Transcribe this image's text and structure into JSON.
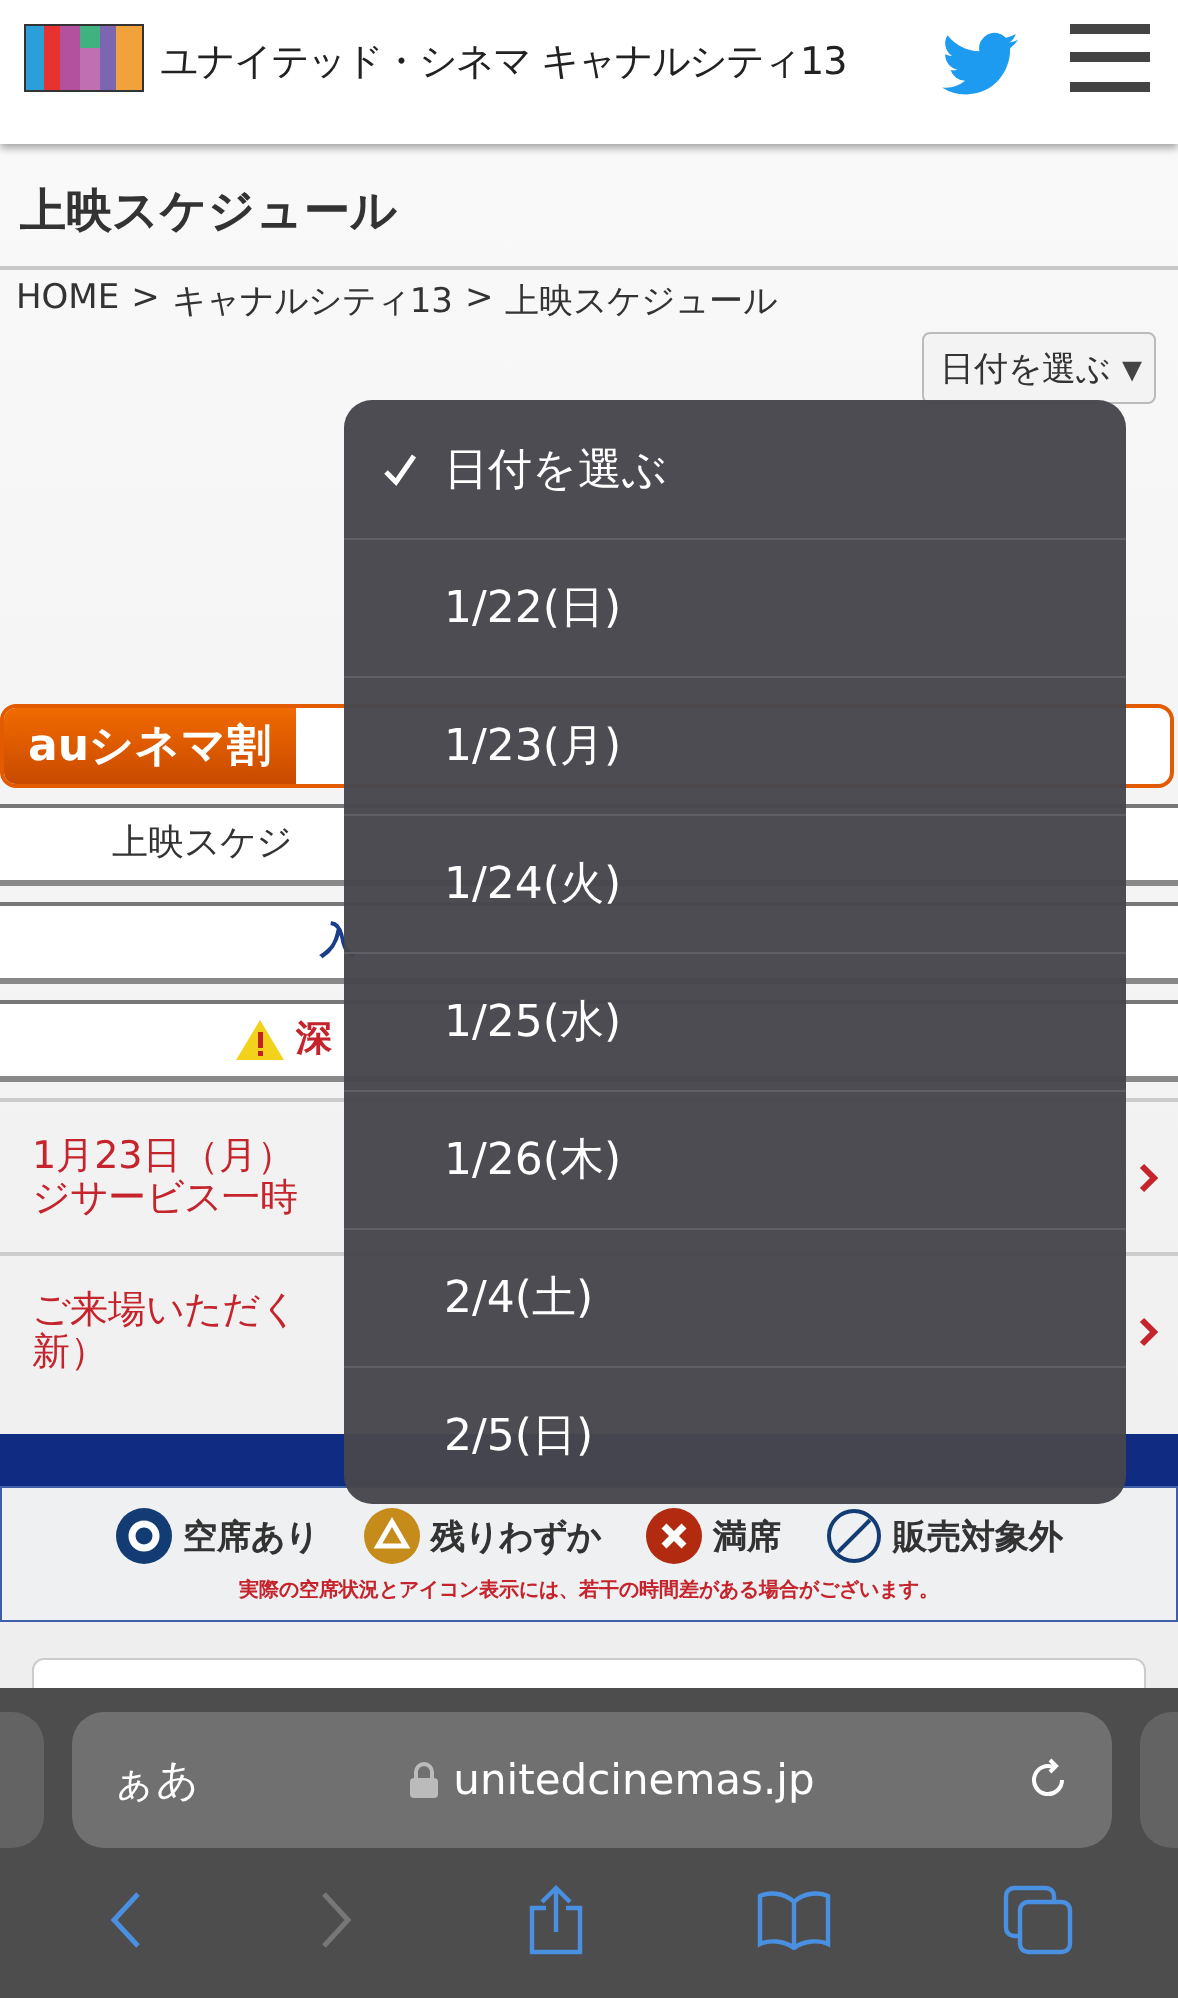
{
  "header": {
    "site_name": "ユナイテッド・シネマ キャナルシティ13"
  },
  "page_title": "上映スケジュール",
  "breadcrumb": [
    "HOME",
    ">",
    "キャナルシティ13",
    ">",
    "上映スケジュール"
  ],
  "date_select": {
    "value": "日付を選ぶ",
    "arrow": "▾"
  },
  "au_banner": {
    "label": "auシネマ割"
  },
  "rows": [
    {
      "kind": "plain",
      "text": "上映スケジ"
    },
    {
      "kind": "link",
      "text": "入"
    },
    {
      "kind": "warning",
      "text": "深"
    }
  ],
  "notices": [
    {
      "lines": [
        "1月23日（月）",
        "ジサービス一時"
      ]
    },
    {
      "lines": [
        "ご来場いただく",
        "新）"
      ]
    }
  ],
  "legend": {
    "items": [
      {
        "kind": "available",
        "label": "空席あり"
      },
      {
        "kind": "few",
        "label": "残りわずか"
      },
      {
        "kind": "full",
        "label": "満席"
      },
      {
        "kind": "none",
        "label": "販売対象外"
      }
    ],
    "note": "実際の空席状況とアイコン表示には、若干の時間差がある場合がございます。"
  },
  "date_menu": [
    {
      "label": "日付を選ぶ",
      "selected": true
    },
    {
      "label": "1/22(日)",
      "selected": false
    },
    {
      "label": "1/23(月)",
      "selected": false
    },
    {
      "label": "1/24(火)",
      "selected": false
    },
    {
      "label": "1/25(水)",
      "selected": false
    },
    {
      "label": "1/26(木)",
      "selected": false
    },
    {
      "label": "2/4(土)",
      "selected": false
    },
    {
      "label": "2/5(日)",
      "selected": false
    }
  ],
  "browser": {
    "text_size": "ぁあ",
    "url": "unitedcinemas.jp"
  }
}
